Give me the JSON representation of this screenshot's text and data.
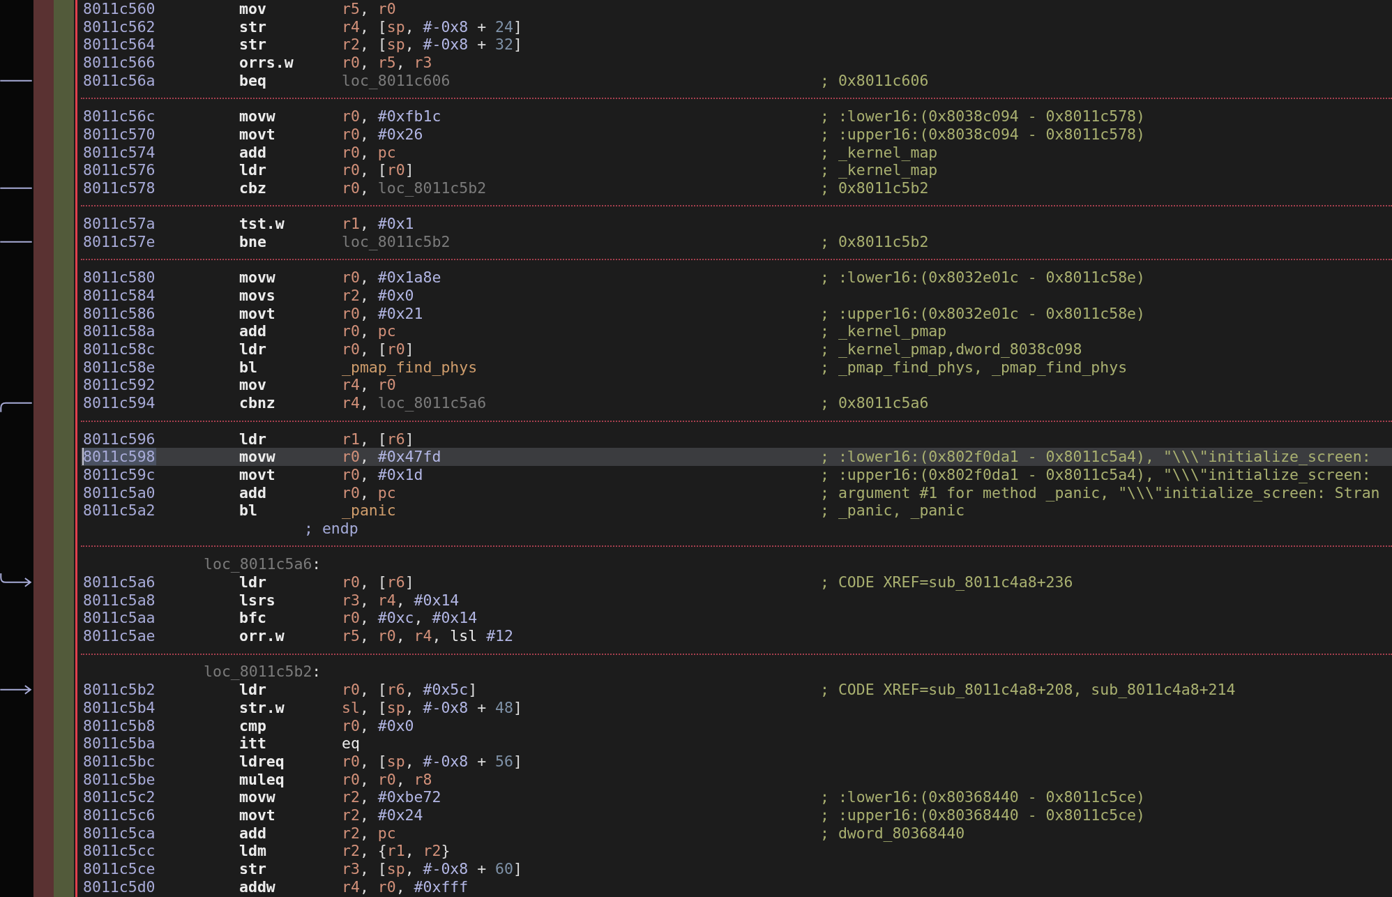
{
  "rows": [
    {
      "kind": "instr",
      "address": "8011c560",
      "mnemonic": "mov",
      "operands": [
        {
          "kind": "reg",
          "text": "r5"
        },
        {
          "kind": "punct",
          "text": ", "
        },
        {
          "kind": "reg",
          "text": "r0"
        }
      ],
      "selected": false
    },
    {
      "kind": "instr",
      "address": "8011c562",
      "mnemonic": "str",
      "operands": [
        {
          "kind": "reg",
          "text": "r4"
        },
        {
          "kind": "punct",
          "text": ", ["
        },
        {
          "kind": "reg",
          "text": "sp"
        },
        {
          "kind": "punct",
          "text": ", "
        },
        {
          "kind": "imm",
          "text": "#-0x8"
        },
        {
          "kind": "punct",
          "text": " + "
        },
        {
          "kind": "off",
          "text": "24"
        },
        {
          "kind": "punct",
          "text": "]"
        }
      ],
      "selected": false
    },
    {
      "kind": "instr",
      "address": "8011c564",
      "mnemonic": "str",
      "operands": [
        {
          "kind": "reg",
          "text": "r2"
        },
        {
          "kind": "punct",
          "text": ", ["
        },
        {
          "kind": "reg",
          "text": "sp"
        },
        {
          "kind": "punct",
          "text": ", "
        },
        {
          "kind": "imm",
          "text": "#-0x8"
        },
        {
          "kind": "punct",
          "text": " + "
        },
        {
          "kind": "off",
          "text": "32"
        },
        {
          "kind": "punct",
          "text": "]"
        }
      ],
      "selected": false
    },
    {
      "kind": "instr",
      "address": "8011c566",
      "mnemonic": "orrs.w",
      "operands": [
        {
          "kind": "reg",
          "text": "r0"
        },
        {
          "kind": "punct",
          "text": ", "
        },
        {
          "kind": "reg",
          "text": "r5"
        },
        {
          "kind": "punct",
          "text": ", "
        },
        {
          "kind": "reg",
          "text": "r3"
        }
      ],
      "selected": false
    },
    {
      "kind": "instr",
      "address": "8011c56a",
      "mnemonic": "beq",
      "operands": [
        {
          "kind": "loc",
          "text": "loc_8011c606"
        }
      ],
      "comment": "; 0x8011c606",
      "selected": false,
      "branch": {
        "kind": "out"
      }
    },
    {
      "kind": "separator"
    },
    {
      "kind": "instr",
      "address": "8011c56c",
      "mnemonic": "movw",
      "operands": [
        {
          "kind": "reg",
          "text": "r0"
        },
        {
          "kind": "punct",
          "text": ", "
        },
        {
          "kind": "imm",
          "text": "#0xfb1c"
        }
      ],
      "comment": "; :lower16:(0x8038c094 - 0x8011c578)",
      "selected": false
    },
    {
      "kind": "instr",
      "address": "8011c570",
      "mnemonic": "movt",
      "operands": [
        {
          "kind": "reg",
          "text": "r0"
        },
        {
          "kind": "punct",
          "text": ", "
        },
        {
          "kind": "imm",
          "text": "#0x26"
        }
      ],
      "comment": "; :upper16:(0x8038c094 - 0x8011c578)",
      "selected": false
    },
    {
      "kind": "instr",
      "address": "8011c574",
      "mnemonic": "add",
      "operands": [
        {
          "kind": "reg",
          "text": "r0"
        },
        {
          "kind": "punct",
          "text": ", "
        },
        {
          "kind": "reg",
          "text": "pc"
        }
      ],
      "comment": "; _kernel_map",
      "selected": false
    },
    {
      "kind": "instr",
      "address": "8011c576",
      "mnemonic": "ldr",
      "operands": [
        {
          "kind": "reg",
          "text": "r0"
        },
        {
          "kind": "punct",
          "text": ", ["
        },
        {
          "kind": "reg",
          "text": "r0"
        },
        {
          "kind": "punct",
          "text": "]"
        }
      ],
      "comment": "; _kernel_map",
      "selected": false
    },
    {
      "kind": "instr",
      "address": "8011c578",
      "mnemonic": "cbz",
      "operands": [
        {
          "kind": "reg",
          "text": "r0"
        },
        {
          "kind": "punct",
          "text": ", "
        },
        {
          "kind": "loc",
          "text": "loc_8011c5b2"
        }
      ],
      "comment": "; 0x8011c5b2",
      "selected": false,
      "branch": {
        "kind": "out"
      }
    },
    {
      "kind": "separator"
    },
    {
      "kind": "instr",
      "address": "8011c57a",
      "mnemonic": "tst.w",
      "operands": [
        {
          "kind": "reg",
          "text": "r1"
        },
        {
          "kind": "punct",
          "text": ", "
        },
        {
          "kind": "imm",
          "text": "#0x1"
        }
      ],
      "selected": false
    },
    {
      "kind": "instr",
      "address": "8011c57e",
      "mnemonic": "bne",
      "operands": [
        {
          "kind": "loc",
          "text": "loc_8011c5b2"
        }
      ],
      "comment": "; 0x8011c5b2",
      "selected": false,
      "branch": {
        "kind": "out"
      }
    },
    {
      "kind": "separator"
    },
    {
      "kind": "instr",
      "address": "8011c580",
      "mnemonic": "movw",
      "operands": [
        {
          "kind": "reg",
          "text": "r0"
        },
        {
          "kind": "punct",
          "text": ", "
        },
        {
          "kind": "imm",
          "text": "#0x1a8e"
        }
      ],
      "comment": "; :lower16:(0x8032e01c - 0x8011c58e)",
      "selected": false
    },
    {
      "kind": "instr",
      "address": "8011c584",
      "mnemonic": "movs",
      "operands": [
        {
          "kind": "reg",
          "text": "r2"
        },
        {
          "kind": "punct",
          "text": ", "
        },
        {
          "kind": "imm",
          "text": "#0x0"
        }
      ],
      "selected": false
    },
    {
      "kind": "instr",
      "address": "8011c586",
      "mnemonic": "movt",
      "operands": [
        {
          "kind": "reg",
          "text": "r0"
        },
        {
          "kind": "punct",
          "text": ", "
        },
        {
          "kind": "imm",
          "text": "#0x21"
        }
      ],
      "comment": "; :upper16:(0x8032e01c - 0x8011c58e)",
      "selected": false
    },
    {
      "kind": "instr",
      "address": "8011c58a",
      "mnemonic": "add",
      "operands": [
        {
          "kind": "reg",
          "text": "r0"
        },
        {
          "kind": "punct",
          "text": ", "
        },
        {
          "kind": "reg",
          "text": "pc"
        }
      ],
      "comment": "; _kernel_pmap",
      "selected": false
    },
    {
      "kind": "instr",
      "address": "8011c58c",
      "mnemonic": "ldr",
      "operands": [
        {
          "kind": "reg",
          "text": "r0"
        },
        {
          "kind": "punct",
          "text": ", ["
        },
        {
          "kind": "reg",
          "text": "r0"
        },
        {
          "kind": "punct",
          "text": "]"
        }
      ],
      "comment": "; _kernel_pmap,dword_8038c098",
      "selected": false
    },
    {
      "kind": "instr",
      "address": "8011c58e",
      "mnemonic": "bl",
      "operands": [
        {
          "kind": "func",
          "text": "_pmap_find_phys"
        }
      ],
      "comment": "; _pmap_find_phys, _pmap_find_phys",
      "selected": false
    },
    {
      "kind": "instr",
      "address": "8011c592",
      "mnemonic": "mov",
      "operands": [
        {
          "kind": "reg",
          "text": "r4"
        },
        {
          "kind": "punct",
          "text": ", "
        },
        {
          "kind": "reg",
          "text": "r0"
        }
      ],
      "selected": false
    },
    {
      "kind": "instr",
      "address": "8011c594",
      "mnemonic": "cbnz",
      "operands": [
        {
          "kind": "reg",
          "text": "r4"
        },
        {
          "kind": "punct",
          "text": ", "
        },
        {
          "kind": "loc",
          "text": "loc_8011c5a6"
        }
      ],
      "comment": "; 0x8011c5a6",
      "selected": false,
      "branch": {
        "kind": "out",
        "curved": true
      }
    },
    {
      "kind": "separator"
    },
    {
      "kind": "instr",
      "address": "8011c596",
      "mnemonic": "ldr",
      "operands": [
        {
          "kind": "reg",
          "text": "r1"
        },
        {
          "kind": "punct",
          "text": ", ["
        },
        {
          "kind": "reg",
          "text": "r6"
        },
        {
          "kind": "punct",
          "text": "]"
        }
      ],
      "selected": false
    },
    {
      "kind": "instr",
      "address": "8011c598",
      "mnemonic": "movw",
      "operands": [
        {
          "kind": "reg",
          "text": "r0"
        },
        {
          "kind": "punct",
          "text": ", "
        },
        {
          "kind": "imm",
          "text": "#0x47fd"
        }
      ],
      "comment": "; :lower16:(0x802f0da1 - 0x8011c5a4), \"\\\\\\\"initialize_screen:",
      "selected": true
    },
    {
      "kind": "instr",
      "address": "8011c59c",
      "mnemonic": "movt",
      "operands": [
        {
          "kind": "reg",
          "text": "r0"
        },
        {
          "kind": "punct",
          "text": ", "
        },
        {
          "kind": "imm",
          "text": "#0x1d"
        }
      ],
      "comment": "; :upper16:(0x802f0da1 - 0x8011c5a4), \"\\\\\\\"initialize_screen:",
      "selected": false
    },
    {
      "kind": "instr",
      "address": "8011c5a0",
      "mnemonic": "add",
      "operands": [
        {
          "kind": "reg",
          "text": "r0"
        },
        {
          "kind": "punct",
          "text": ", "
        },
        {
          "kind": "reg",
          "text": "pc"
        }
      ],
      "comment": "; argument #1 for method _panic, \"\\\\\\\"initialize_screen: Stran",
      "selected": false
    },
    {
      "kind": "instr",
      "address": "8011c5a2",
      "mnemonic": "bl",
      "operands": [
        {
          "kind": "func",
          "text": "_panic"
        }
      ],
      "comment": "; _panic, _panic",
      "selected": false
    },
    {
      "kind": "endp",
      "text": "; endp"
    },
    {
      "kind": "separator"
    },
    {
      "kind": "label",
      "text": "loc_8011c5a6",
      "suffix": ":"
    },
    {
      "kind": "instr",
      "address": "8011c5a6",
      "mnemonic": "ldr",
      "operands": [
        {
          "kind": "reg",
          "text": "r0"
        },
        {
          "kind": "punct",
          "text": ", ["
        },
        {
          "kind": "reg",
          "text": "r6"
        },
        {
          "kind": "punct",
          "text": "]"
        }
      ],
      "comment": "; CODE XREF=sub_8011c4a8+236",
      "selected": false,
      "branch": {
        "kind": "in",
        "curved": true
      }
    },
    {
      "kind": "instr",
      "address": "8011c5a8",
      "mnemonic": "lsrs",
      "operands": [
        {
          "kind": "reg",
          "text": "r3"
        },
        {
          "kind": "punct",
          "text": ", "
        },
        {
          "kind": "reg",
          "text": "r4"
        },
        {
          "kind": "punct",
          "text": ", "
        },
        {
          "kind": "imm",
          "text": "#0x14"
        }
      ],
      "selected": false
    },
    {
      "kind": "instr",
      "address": "8011c5aa",
      "mnemonic": "bfc",
      "operands": [
        {
          "kind": "reg",
          "text": "r0"
        },
        {
          "kind": "punct",
          "text": ", "
        },
        {
          "kind": "imm",
          "text": "#0xc"
        },
        {
          "kind": "punct",
          "text": ", "
        },
        {
          "kind": "imm",
          "text": "#0x14"
        }
      ],
      "selected": false
    },
    {
      "kind": "instr",
      "address": "8011c5ae",
      "mnemonic": "orr.w",
      "operands": [
        {
          "kind": "reg",
          "text": "r5"
        },
        {
          "kind": "punct",
          "text": ", "
        },
        {
          "kind": "reg",
          "text": "r0"
        },
        {
          "kind": "punct",
          "text": ", "
        },
        {
          "kind": "reg",
          "text": "r4"
        },
        {
          "kind": "punct",
          "text": ", "
        },
        {
          "kind": "plain",
          "text": "lsl "
        },
        {
          "kind": "imm",
          "text": "#12"
        }
      ],
      "selected": false
    },
    {
      "kind": "separator"
    },
    {
      "kind": "label",
      "text": "loc_8011c5b2",
      "suffix": ":"
    },
    {
      "kind": "instr",
      "address": "8011c5b2",
      "mnemonic": "ldr",
      "operands": [
        {
          "kind": "reg",
          "text": "r0"
        },
        {
          "kind": "punct",
          "text": ", ["
        },
        {
          "kind": "reg",
          "text": "r6"
        },
        {
          "kind": "punct",
          "text": ", "
        },
        {
          "kind": "imm",
          "text": "#0x5c"
        },
        {
          "kind": "punct",
          "text": "]"
        }
      ],
      "comment": "; CODE XREF=sub_8011c4a8+208, sub_8011c4a8+214",
      "selected": false,
      "branch": {
        "kind": "in"
      }
    },
    {
      "kind": "instr",
      "address": "8011c5b4",
      "mnemonic": "str.w",
      "operands": [
        {
          "kind": "reg",
          "text": "sl"
        },
        {
          "kind": "punct",
          "text": ", ["
        },
        {
          "kind": "reg",
          "text": "sp"
        },
        {
          "kind": "punct",
          "text": ", "
        },
        {
          "kind": "imm",
          "text": "#-0x8"
        },
        {
          "kind": "punct",
          "text": " + "
        },
        {
          "kind": "off",
          "text": "48"
        },
        {
          "kind": "punct",
          "text": "]"
        }
      ],
      "selected": false
    },
    {
      "kind": "instr",
      "address": "8011c5b8",
      "mnemonic": "cmp",
      "operands": [
        {
          "kind": "reg",
          "text": "r0"
        },
        {
          "kind": "punct",
          "text": ", "
        },
        {
          "kind": "imm",
          "text": "#0x0"
        }
      ],
      "selected": false
    },
    {
      "kind": "instr",
      "address": "8011c5ba",
      "mnemonic": "itt",
      "operands": [
        {
          "kind": "plain",
          "text": "eq"
        }
      ],
      "selected": false
    },
    {
      "kind": "instr",
      "address": "8011c5bc",
      "mnemonic": "ldreq",
      "operands": [
        {
          "kind": "reg",
          "text": "r0"
        },
        {
          "kind": "punct",
          "text": ", ["
        },
        {
          "kind": "reg",
          "text": "sp"
        },
        {
          "kind": "punct",
          "text": ", "
        },
        {
          "kind": "imm",
          "text": "#-0x8"
        },
        {
          "kind": "punct",
          "text": " + "
        },
        {
          "kind": "off",
          "text": "56"
        },
        {
          "kind": "punct",
          "text": "]"
        }
      ],
      "selected": false
    },
    {
      "kind": "instr",
      "address": "8011c5be",
      "mnemonic": "muleq",
      "operands": [
        {
          "kind": "reg",
          "text": "r0"
        },
        {
          "kind": "punct",
          "text": ", "
        },
        {
          "kind": "reg",
          "text": "r0"
        },
        {
          "kind": "punct",
          "text": ", "
        },
        {
          "kind": "reg",
          "text": "r8"
        }
      ],
      "selected": false
    },
    {
      "kind": "instr",
      "address": "8011c5c2",
      "mnemonic": "movw",
      "operands": [
        {
          "kind": "reg",
          "text": "r2"
        },
        {
          "kind": "punct",
          "text": ", "
        },
        {
          "kind": "imm",
          "text": "#0xbe72"
        }
      ],
      "comment": "; :lower16:(0x80368440 - 0x8011c5ce)",
      "selected": false
    },
    {
      "kind": "instr",
      "address": "8011c5c6",
      "mnemonic": "movt",
      "operands": [
        {
          "kind": "reg",
          "text": "r2"
        },
        {
          "kind": "punct",
          "text": ", "
        },
        {
          "kind": "imm",
          "text": "#0x24"
        }
      ],
      "comment": "; :upper16:(0x80368440 - 0x8011c5ce)",
      "selected": false
    },
    {
      "kind": "instr",
      "address": "8011c5ca",
      "mnemonic": "add",
      "operands": [
        {
          "kind": "reg",
          "text": "r2"
        },
        {
          "kind": "punct",
          "text": ", "
        },
        {
          "kind": "reg",
          "text": "pc"
        }
      ],
      "comment": "; dword_80368440",
      "selected": false
    },
    {
      "kind": "instr",
      "address": "8011c5cc",
      "mnemonic": "ldm",
      "operands": [
        {
          "kind": "reg",
          "text": "r2"
        },
        {
          "kind": "punct",
          "text": ", {"
        },
        {
          "kind": "reg",
          "text": "r1"
        },
        {
          "kind": "punct",
          "text": ", "
        },
        {
          "kind": "reg",
          "text": "r2"
        },
        {
          "kind": "punct",
          "text": "}"
        }
      ],
      "selected": false
    },
    {
      "kind": "instr",
      "address": "8011c5ce",
      "mnemonic": "str",
      "operands": [
        {
          "kind": "reg",
          "text": "r3"
        },
        {
          "kind": "punct",
          "text": ", ["
        },
        {
          "kind": "reg",
          "text": "sp"
        },
        {
          "kind": "punct",
          "text": ", "
        },
        {
          "kind": "imm",
          "text": "#-0x8"
        },
        {
          "kind": "punct",
          "text": " + "
        },
        {
          "kind": "off",
          "text": "60"
        },
        {
          "kind": "punct",
          "text": "]"
        }
      ],
      "selected": false
    },
    {
      "kind": "instr",
      "address": "8011c5d0",
      "mnemonic": "addw",
      "operands": [
        {
          "kind": "reg",
          "text": "r4"
        },
        {
          "kind": "punct",
          "text": ", "
        },
        {
          "kind": "reg",
          "text": "r0"
        },
        {
          "kind": "punct",
          "text": ", "
        },
        {
          "kind": "imm",
          "text": "#0xfff"
        }
      ],
      "selected": false
    }
  ]
}
